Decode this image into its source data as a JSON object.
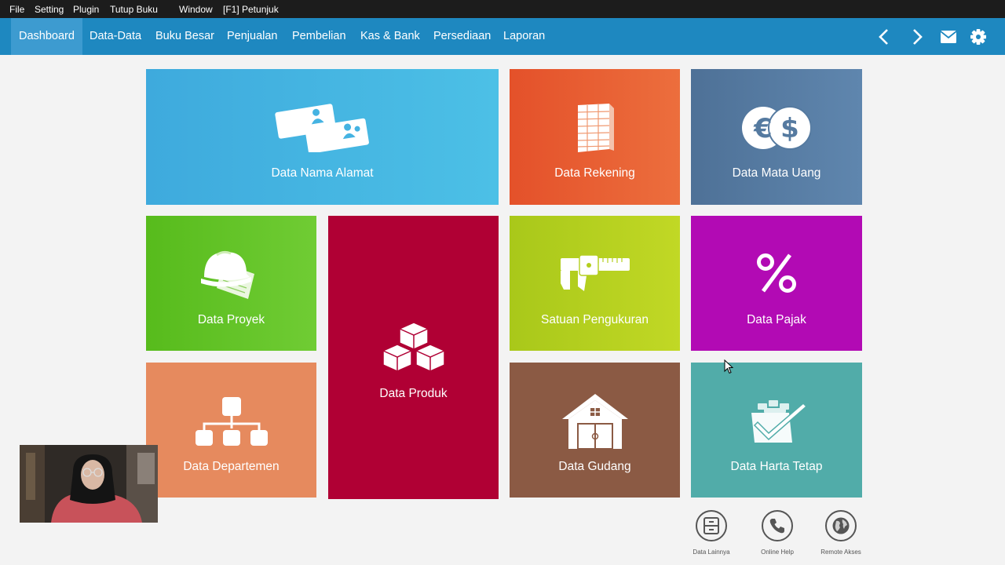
{
  "menubar": {
    "items": [
      "File",
      "Setting",
      "Plugin",
      "Tutup Buku",
      "Window",
      "[F1] Petunjuk"
    ]
  },
  "nav": {
    "items": [
      "Dashboard",
      "Data-Data",
      "Buku Besar",
      "Penjualan",
      "Pembelian",
      "Kas & Bank",
      "Persediaan",
      "Laporan"
    ],
    "active": "Dashboard",
    "icons": [
      "chevron-left-icon",
      "chevron-right-icon",
      "mail-icon",
      "gear-icon"
    ]
  },
  "tiles": {
    "nama_alamat": "Data Nama Alamat",
    "rekening": "Data Rekening",
    "mata_uang": "Data Mata Uang",
    "proyek": "Data Proyek",
    "produk": "Data Produk",
    "satuan": "Satuan Pengukuran",
    "pajak": "Data Pajak",
    "departemen": "Data Departemen",
    "gudang": "Data Gudang",
    "harta_tetap": "Data Harta Tetap"
  },
  "tile_colors": {
    "nama_alamat": "#45b3e2",
    "rekening": "#e8602c",
    "mata_uang": "#557aa0",
    "proyek": "#5ec127",
    "produk": "#b00034",
    "satuan": "#b4cf1e",
    "pajak": "#b20ab4",
    "departemen": "#e68a5e",
    "gudang": "#8b5a44",
    "harta_tetap": "#51aca9"
  },
  "shortcuts": {
    "data_lainnya": "Data Lainnya",
    "online_help": "Online Help",
    "remote_akses": "Remote Akses"
  }
}
